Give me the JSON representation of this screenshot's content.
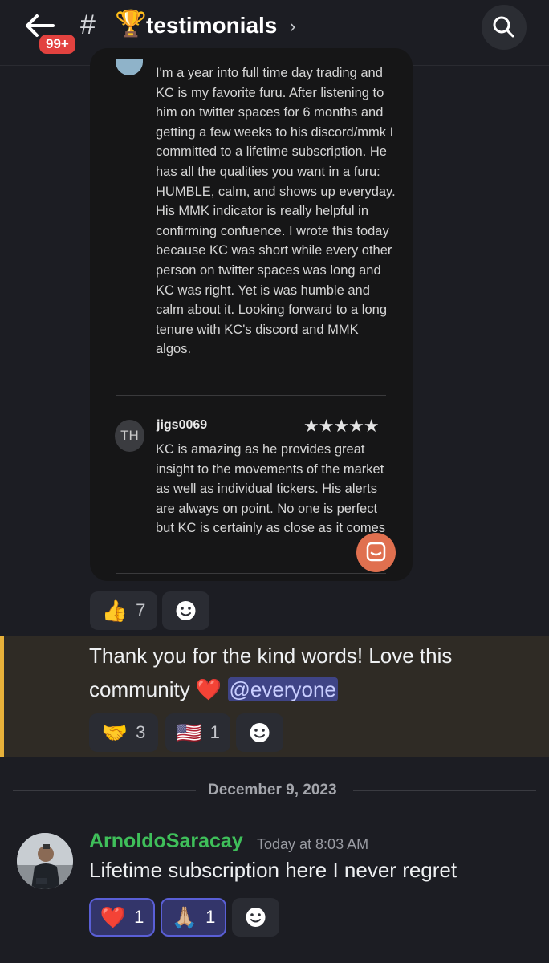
{
  "header": {
    "unread_badge": "99+",
    "channel_prefix": "#",
    "channel_emoji": "🏆",
    "channel_name": "testimonials",
    "chevron": "›",
    "back_icon": "arrow-left-icon",
    "search_icon": "search-icon"
  },
  "embed": {
    "review_1": "I'm a year into full time day trading and KC is my favorite furu. After listening to him on twitter spaces for 6 months and getting a few weeks to his discord/mmk I committed to a lifetime subscription. He has all the qualities you want in a furu: HUMBLE, calm, and shows up everyday. His MMK indicator is really helpful in confirming confuence. I wrote this today because KC was short while every other person on twitter spaces was long and KC was right. Yet is was humble and calm about it. Looking forward to a long tenure with KC's discord and MMK algos.",
    "reviewer_2": {
      "initials": "TH",
      "name": "jigs0069",
      "stars": "★★★★★",
      "rating": 5,
      "text": "KC is amazing as he provides great insight to the movements of the market as well as individual tickers. His alerts are always on point. No one is perfect but KC is certainly as close as it comes"
    }
  },
  "reactions_1": [
    {
      "emoji": "👍",
      "count": "7"
    }
  ],
  "highlighted_message": {
    "text": "Thank you for the kind words! Love this community ❤️",
    "mention": "@everyone",
    "reactions": [
      {
        "emoji": "🤝",
        "count": "3"
      },
      {
        "emoji": "🇺🇸",
        "count": "1"
      }
    ]
  },
  "date_divider": "December 9, 2023",
  "last_message": {
    "username": "ArnoldoSaracay",
    "timestamp": "Today at 8:03 AM",
    "text": "Lifetime subscription here I never regret",
    "reactions": [
      {
        "emoji": "❤️",
        "count": "1"
      },
      {
        "emoji": "🙏🏼",
        "count": "1"
      }
    ]
  },
  "colors": {
    "background": "#1c1d23",
    "highlight_bar": "#e7b13a",
    "username": "#3fbf5a",
    "badge": "#e2423f",
    "mention_bg": "#3f4486"
  }
}
